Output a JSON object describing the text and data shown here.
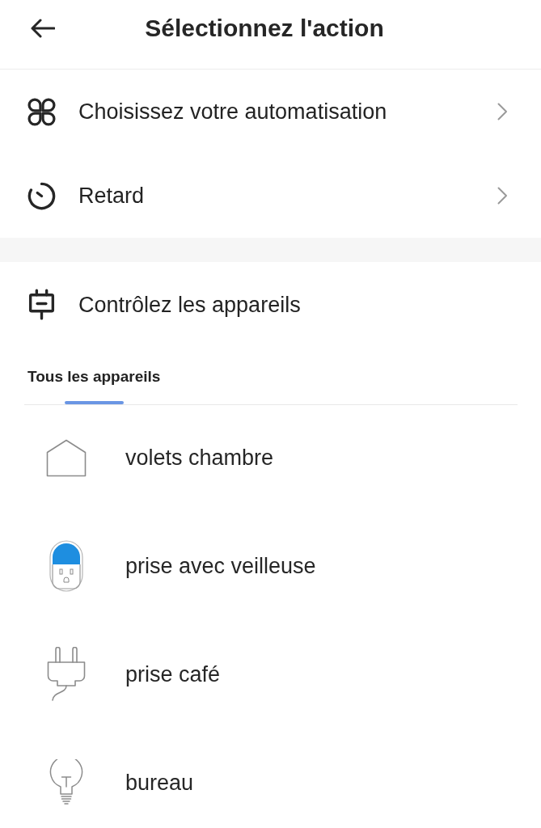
{
  "header": {
    "title": "Sélectionnez l'action"
  },
  "actions": [
    {
      "kind": "automation",
      "label": "Choisissez votre automatisation"
    },
    {
      "kind": "delay",
      "label": "Retard"
    }
  ],
  "device_section": {
    "title": "Contrôlez les appareils",
    "tabs": [
      {
        "label": "Tous les appareils",
        "selected": true
      }
    ],
    "devices": [
      {
        "kind": "cover",
        "name": "volets chambre"
      },
      {
        "kind": "socket",
        "name": "prise avec veilleuse"
      },
      {
        "kind": "plug",
        "name": "prise café"
      },
      {
        "kind": "light",
        "name": "bureau"
      }
    ]
  }
}
